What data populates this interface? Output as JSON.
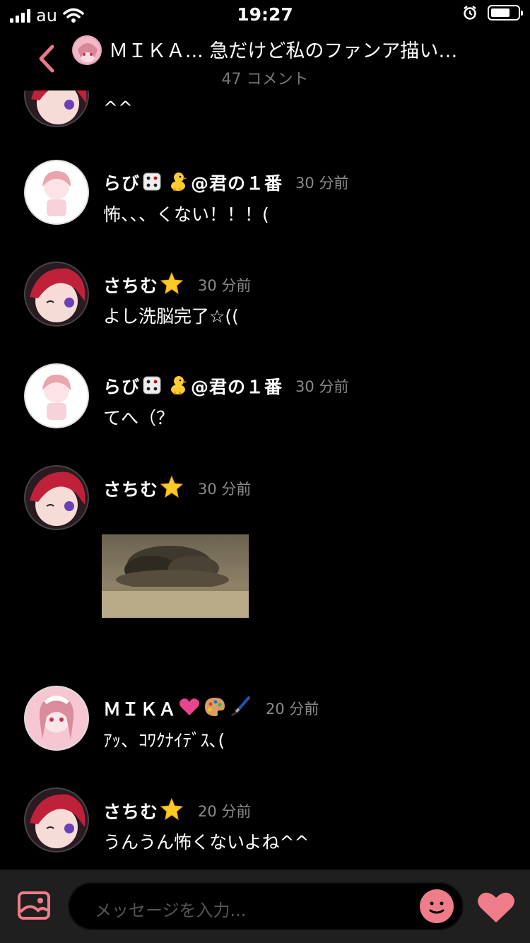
{
  "status_bar": {
    "carrier": "au",
    "time": "19:27"
  },
  "header": {
    "title": "ＭＩＫＡ... 急だけど私のファンア描い…",
    "subtitle": "47 コメント",
    "accent": "#e8798b"
  },
  "messages": [
    {
      "name": "",
      "time": "",
      "text": "^^"
    },
    {
      "name": "らび",
      "name_suffix": "@君の１番",
      "emojis": [
        "dice-icon",
        "chick-icon"
      ],
      "time": "30 分前",
      "text": "怖、、、くない！！！("
    },
    {
      "name": "さちむ",
      "emojis": [
        "star-icon"
      ],
      "time": "30 分前",
      "text": "よし洗脳完了☆(("
    },
    {
      "name": "らび",
      "name_suffix": "@君の１番",
      "emojis": [
        "dice-icon",
        "chick-icon"
      ],
      "time": "30 分前",
      "text": "てへ（？"
    },
    {
      "name": "さちむ",
      "emojis": [
        "star-icon"
      ],
      "time": "30 分前",
      "text": ""
    },
    {
      "name": "ＭＩＫＡ",
      "emojis": [
        "pink-heart-icon",
        "palette-icon",
        "paintbrush-icon"
      ],
      "time": "20 分前",
      "text": "ｱｯ、ｺﾜｸﾅｲﾃﾞｽ､("
    },
    {
      "name": "さちむ",
      "emojis": [
        "star-icon"
      ],
      "time": "20 分前",
      "text": "うんうん怖くないよね^^"
    }
  ],
  "composer": {
    "placeholder": "メッセージを入力..."
  }
}
